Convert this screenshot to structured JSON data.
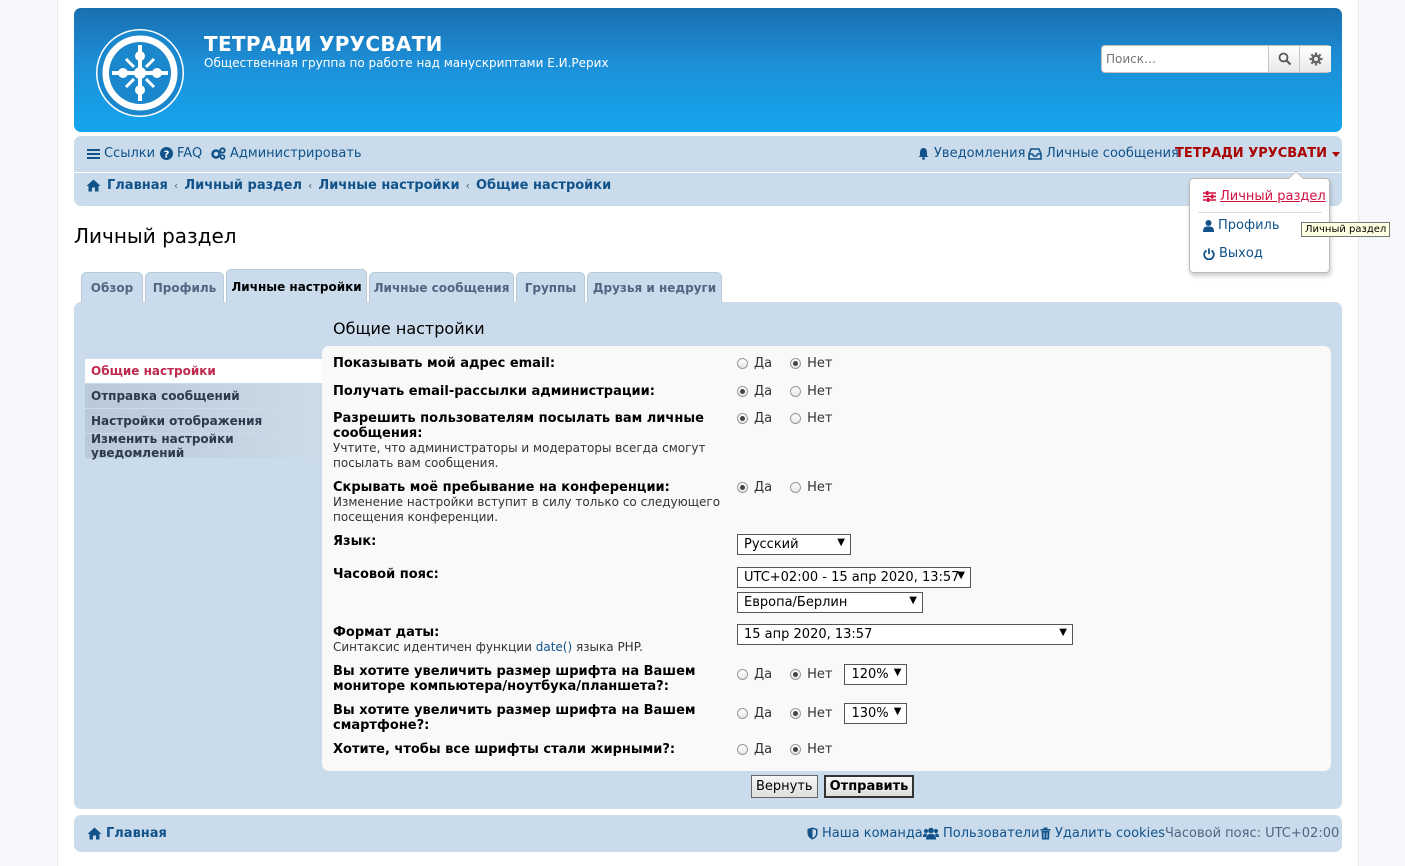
{
  "site": {
    "title": "ТЕТРАДИ УРУСВАТИ",
    "description": "Общественная группа по работе над манускриптами Е.И.Рерих"
  },
  "search": {
    "placeholder": "Поиск…"
  },
  "nav": {
    "links": "Ссылки",
    "faq": "FAQ",
    "admin": "Администрировать",
    "notifications": "Уведомления",
    "messages": "Личные сообщения",
    "username": "ТЕТРАДИ УРУСВАТИ"
  },
  "breadcrumb": [
    "Главная",
    "Личный раздел",
    "Личные настройки",
    "Общие настройки"
  ],
  "user_menu": {
    "items": [
      "Личный раздел",
      "Профиль",
      "Выход"
    ],
    "tooltip": "Личный раздел"
  },
  "page_title": "Личный раздел",
  "tabs": [
    "Обзор",
    "Профиль",
    "Личные настройки",
    "Личные сообщения",
    "Группы",
    "Друзья и недруги"
  ],
  "side_menu": [
    "Общие настройки",
    "Отправка сообщений",
    "Настройки отображения",
    "Изменить настройки уведомлений"
  ],
  "panel_title": "Общие настройки",
  "yes": "Да",
  "no": "Нет",
  "settings": {
    "email": {
      "label": "Показывать мой адрес email:",
      "value": "no"
    },
    "admin_mail": {
      "label": "Получать email-рассылки администрации:",
      "value": "yes"
    },
    "pm": {
      "label": "Разрешить пользователям посылать вам личные сообщения:",
      "explain": "Учтите, что администраторы и модераторы всегда смогут посылать вам сообщения.",
      "value": "yes"
    },
    "hide_online": {
      "label": "Скрывать моё пребывание на конференции:",
      "explain": "Изменение настройки вступит в силу только со следующего посещения конференции.",
      "value": "yes"
    },
    "language": {
      "label": "Язык:",
      "selected": "Русский"
    },
    "timezone": {
      "label": "Часовой пояс:",
      "selected": "UTC+02:00 - 15 апр 2020, 13:57",
      "region": "Европа/Берлин"
    },
    "date_format": {
      "label": "Формат даты:",
      "explain_pre": "Синтаксис идентичен функции ",
      "explain_link": "date()",
      "explain_post": " языка PHP.",
      "selected": "15 апр 2020, 13:57"
    },
    "font_desktop": {
      "label": "Вы хотите увеличить размер шрифта на Вашем мониторе компьютера/ноутбука/планшета?:",
      "value": "no",
      "size": "120%"
    },
    "font_mobile": {
      "label": "Вы хотите увеличить размер шрифта на Вашем смартфоне?:",
      "value": "no",
      "size": "130%"
    },
    "bold": {
      "label": "Хотите, чтобы все шрифты стали жирными?:",
      "value": "no"
    }
  },
  "buttons": {
    "reset": "Вернуть",
    "submit": "Отправить"
  },
  "footer": {
    "home": "Главная",
    "team": "Наша команда",
    "users": "Пользователи",
    "cookies": "Удалить cookies",
    "timezone": "Часовой пояс: UTC+02:00"
  },
  "colors": {
    "header": "#1c8fd8",
    "nav": "#cadceb",
    "link": "#105289",
    "user": "#aa0000",
    "active_menu": "#bc2a4d"
  }
}
